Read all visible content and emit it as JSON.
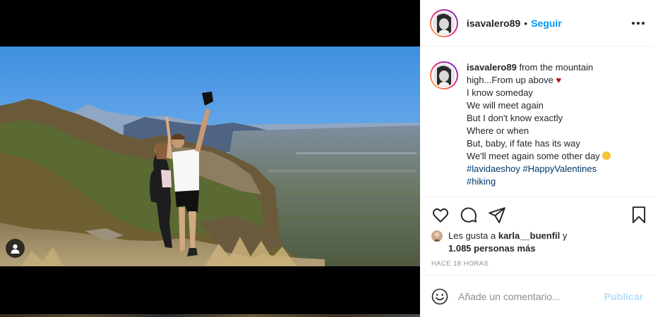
{
  "header": {
    "username": "isavalero89",
    "separator": "•",
    "follow_label": "Seguir",
    "more_icon": "more-options-icon"
  },
  "caption": {
    "username": "isavalero89",
    "lines": [
      "from the mountain",
      "high...From up above",
      "I know someday",
      "We will meet again",
      "But I don't know exactly",
      "Where or when",
      "But, baby, if fate has its way",
      "We'll meet again some other day"
    ],
    "hashtags": [
      "#lavidaeshoy",
      "#HappyValentines",
      "#hiking"
    ]
  },
  "actions": {
    "like_icon": "heart-icon",
    "comment_icon": "comment-icon",
    "share_icon": "paper-plane-icon",
    "save_icon": "bookmark-icon"
  },
  "likes": {
    "prefix": "Les gusta a",
    "user": "karla__buenfil",
    "conjunction": "y",
    "count_text": "1.085 personas más"
  },
  "timestamp": "HACE 18 HORAS",
  "comment_bar": {
    "emoji_icon": "emoji-icon",
    "placeholder": "Añade un comentario...",
    "publish_label": "Publicar"
  },
  "media": {
    "tag_icon": "user-tag-icon"
  },
  "colors": {
    "link_blue": "#0095f6",
    "hashtag": "#00376b",
    "publish_disabled": "#b2dffc",
    "muted": "#8e8e8e",
    "text": "#262626"
  }
}
